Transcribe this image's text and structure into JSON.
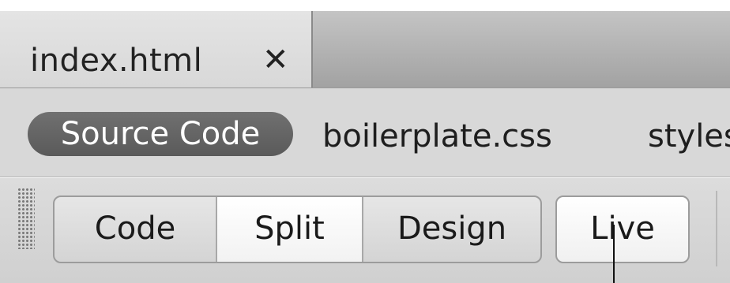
{
  "document_tab": {
    "label": "index.html",
    "close_symbol": "✕"
  },
  "related_files": {
    "active": "Source Code",
    "items": [
      "boilerplate.css",
      "styles"
    ]
  },
  "view_toolbar": {
    "segments": [
      {
        "label": "Code",
        "selected": false
      },
      {
        "label": "Split",
        "selected": true
      },
      {
        "label": "Design",
        "selected": false
      }
    ],
    "live_label": "Live"
  },
  "colors": {
    "pill_background": "#626262",
    "tab_strip": "#b4b4b4",
    "toolbar": "#d6d6d6"
  }
}
